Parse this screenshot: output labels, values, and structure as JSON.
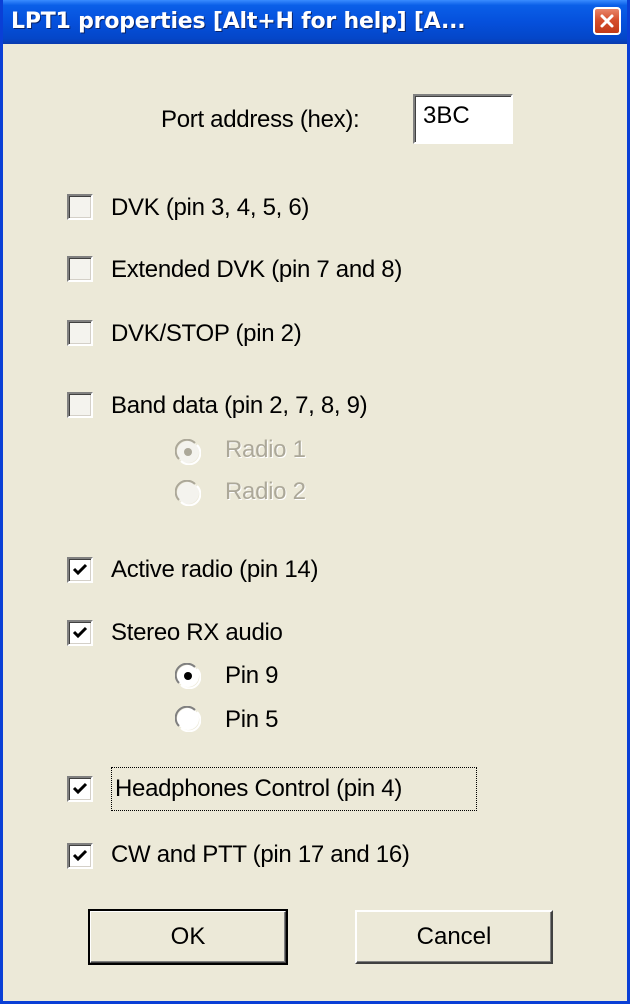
{
  "window": {
    "title": "LPT1 properties [Alt+H for help] [A...",
    "close_icon": "close-icon"
  },
  "port": {
    "label": "Port address (hex):",
    "value": "3BC"
  },
  "options": {
    "dvk": {
      "label": "DVK (pin 3, 4, 5, 6)",
      "checked": false
    },
    "extended_dvk": {
      "label": "Extended DVK (pin 7 and 8)",
      "checked": false
    },
    "dvk_stop": {
      "label": "DVK/STOP (pin 2)",
      "checked": false
    },
    "band_data": {
      "label": "Band data (pin 2, 7, 8, 9)",
      "checked": false,
      "radio1": {
        "label": "Radio 1",
        "selected": true,
        "enabled": false
      },
      "radio2": {
        "label": "Radio 2",
        "selected": false,
        "enabled": false
      }
    },
    "active_radio": {
      "label": "Active radio (pin 14)",
      "checked": true
    },
    "stereo_rx": {
      "label": "Stereo RX audio",
      "checked": true,
      "pin9": {
        "label": "Pin 9",
        "selected": true
      },
      "pin5": {
        "label": "Pin 5",
        "selected": false
      }
    },
    "headphones": {
      "label": "Headphones Control (pin 4)",
      "checked": true,
      "focused": true
    },
    "cw_ptt": {
      "label": "CW and PTT (pin 17 and 16)",
      "checked": true
    }
  },
  "buttons": {
    "ok": "OK",
    "cancel": "Cancel"
  }
}
